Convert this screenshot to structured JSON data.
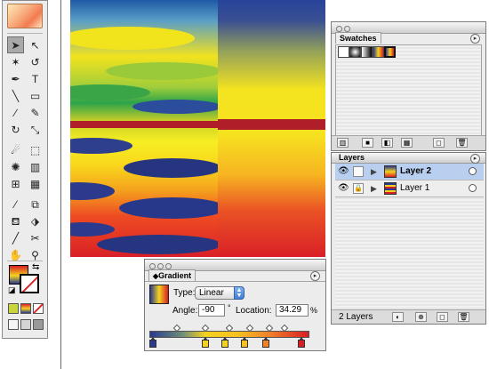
{
  "toolbox": {
    "tools": [
      {
        "name": "selection-tool-icon",
        "glyph": "➤",
        "selected": true
      },
      {
        "name": "direct-selection-tool-icon",
        "glyph": "↖",
        "selected": false
      },
      {
        "name": "magic-wand-tool-icon",
        "glyph": "✶",
        "selected": false
      },
      {
        "name": "lasso-tool-icon",
        "glyph": "↺",
        "selected": false
      },
      {
        "name": "pen-tool-icon",
        "glyph": "✒",
        "selected": false
      },
      {
        "name": "type-tool-icon",
        "glyph": "T",
        "selected": false
      },
      {
        "name": "line-segment-tool-icon",
        "glyph": "╲",
        "selected": false
      },
      {
        "name": "rectangle-tool-icon",
        "glyph": "▭",
        "selected": false
      },
      {
        "name": "paintbrush-tool-icon",
        "glyph": "∕",
        "selected": false
      },
      {
        "name": "pencil-tool-icon",
        "glyph": "✎",
        "selected": false
      },
      {
        "name": "rotate-tool-icon",
        "glyph": "↻",
        "selected": false
      },
      {
        "name": "scale-tool-icon",
        "glyph": "⤡",
        "selected": false
      },
      {
        "name": "warp-tool-icon",
        "glyph": "☄",
        "selected": false
      },
      {
        "name": "free-transform-tool-icon",
        "glyph": "⬚",
        "selected": false
      },
      {
        "name": "symbol-sprayer-tool-icon",
        "glyph": "✺",
        "selected": false
      },
      {
        "name": "column-graph-tool-icon",
        "glyph": "▥",
        "selected": false
      },
      {
        "name": "mesh-tool-icon",
        "glyph": "⊞",
        "selected": false
      },
      {
        "name": "gradient-tool-icon",
        "glyph": "▦",
        "selected": false
      },
      {
        "name": "eyedropper-tool-icon",
        "glyph": "⁄",
        "selected": false
      },
      {
        "name": "blend-tool-icon",
        "glyph": "⧉",
        "selected": false
      },
      {
        "name": "live-paint-bucket-tool-icon",
        "glyph": "⛾",
        "selected": false
      },
      {
        "name": "live-paint-selection-tool-icon",
        "glyph": "⬗",
        "selected": false
      },
      {
        "name": "slice-tool-icon",
        "glyph": "╱",
        "selected": false
      },
      {
        "name": "scissors-tool-icon",
        "glyph": "✂",
        "selected": false
      },
      {
        "name": "hand-tool-icon",
        "glyph": "✋",
        "selected": false
      },
      {
        "name": "zoom-tool-icon",
        "glyph": "⚲",
        "selected": false
      }
    ],
    "swap_glyph": "⇆",
    "default_colors_glyph": "◪"
  },
  "swatches": {
    "tab_label": "Swatches",
    "menu_glyph": "▸",
    "items": [
      {
        "name": "swatch-none",
        "color": "#ffffff"
      },
      {
        "name": "swatch-radial-gradient",
        "color": "radial-gradient(circle,#ffffff 0%,#000000 100%)"
      },
      {
        "name": "swatch-linear-gradient",
        "color": "linear-gradient(90deg,#ffffff,#000000)"
      },
      {
        "name": "swatch-rainbow-gradient",
        "color": "linear-gradient(90deg,#2a3a8e,#f5d21e,#d81e25)"
      },
      {
        "name": "swatch-selected-gradient",
        "color": "linear-gradient(90deg,#2a3a8e,#f5d21e,#d81e25)"
      }
    ]
  },
  "layers": {
    "tab_label": "Layers",
    "menu_glyph": "▸",
    "eye_glyph": "👁",
    "expand_glyph": "▶",
    "lock_glyph": "🔒",
    "rows": [
      {
        "name": "Layer 2",
        "active": true,
        "locked": false
      },
      {
        "name": "Layer 1",
        "active": false,
        "locked": true
      }
    ],
    "footer_count": "2 Layers"
  },
  "gradient": {
    "tab_label": "Gradient",
    "tab_glyph": "◆",
    "menu_glyph": "▸",
    "type_label": "Type:",
    "type_value": "Linear",
    "angle_label": "Angle:",
    "angle_value": "-90",
    "angle_unit": "°",
    "location_label": "Location:",
    "location_value": "34.29",
    "location_unit": "%",
    "stops": [
      {
        "color": "#2a3a8e"
      },
      {
        "color": "#f5d21e"
      },
      {
        "color": "#f5d21e"
      },
      {
        "color": "#f6c11f"
      },
      {
        "color": "#f0822a"
      },
      {
        "color": "#d81e25"
      }
    ]
  }
}
